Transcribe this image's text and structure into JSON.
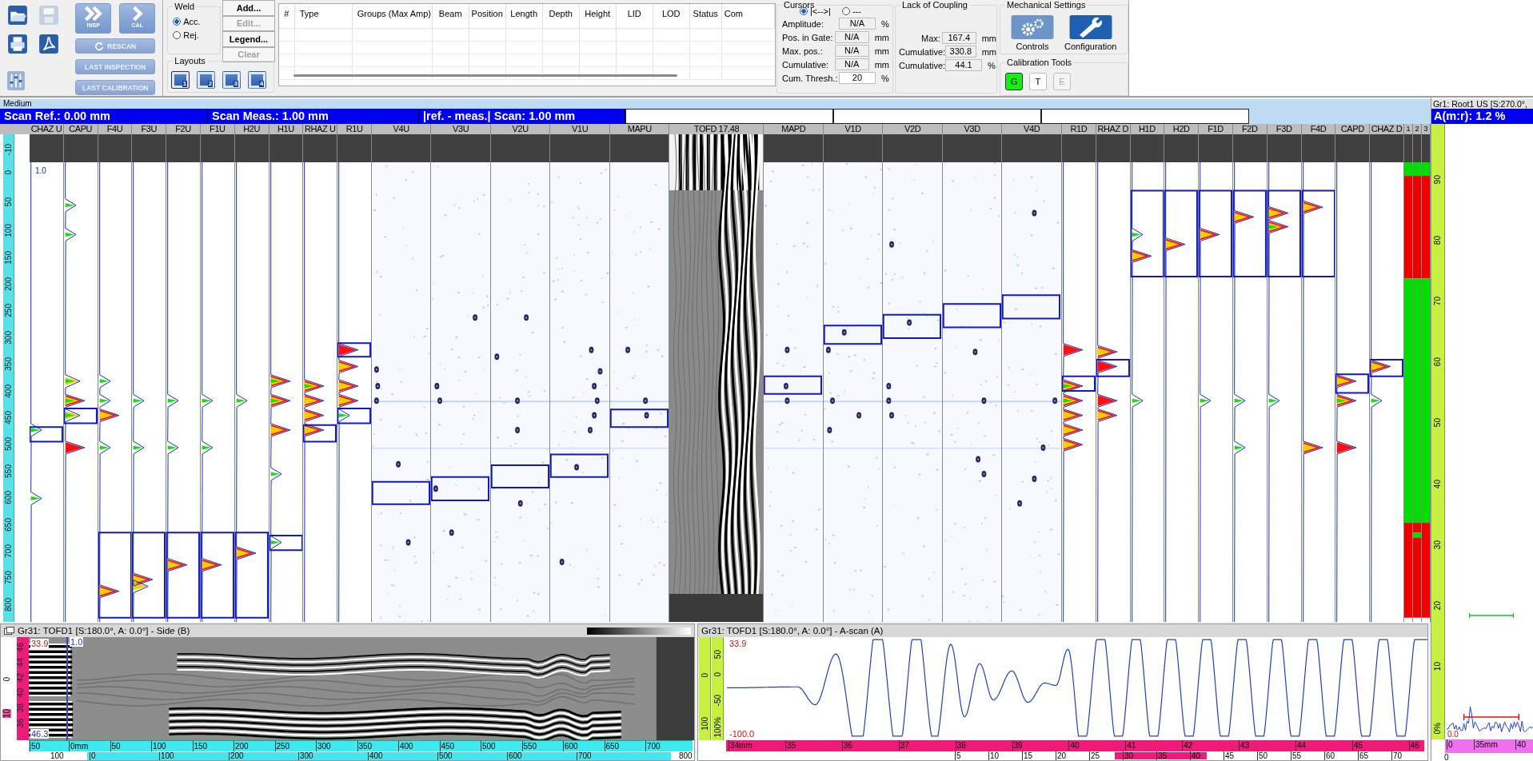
{
  "toolbar": {
    "mode_buttons": [
      {
        "label": "INSP"
      },
      {
        "label": "CAL"
      }
    ],
    "action_buttons": [
      {
        "label": "RESCAN"
      },
      {
        "label": "LAST INSPECTION"
      },
      {
        "label": "LAST CALIBRATION"
      }
    ],
    "weld": {
      "title": "Weld",
      "options": [
        {
          "label": "Acc.",
          "selected": true
        },
        {
          "label": "Rej.",
          "selected": false
        }
      ]
    },
    "indication_buttons": [
      {
        "label": "Add...",
        "disabled": false
      },
      {
        "label": "Edit...",
        "disabled": true
      },
      {
        "label": "Legend...",
        "disabled": false
      },
      {
        "label": "Clear",
        "disabled": true
      }
    ],
    "layouts": {
      "title": "Layouts",
      "buttons": [
        {
          "label": "1",
          "selected": true
        },
        {
          "label": "2",
          "selected": false
        },
        {
          "label": "3",
          "selected": false
        },
        {
          "label": "4",
          "selected": false
        }
      ]
    },
    "indication_table": {
      "columns": [
        "#",
        "Type",
        "Groups (Max Amp)",
        "Beam",
        "Position",
        "Length",
        "Depth",
        "Height",
        "LID",
        "LOD",
        "Status",
        "Com"
      ]
    },
    "cursors": {
      "title": "Cursors",
      "modes": [
        {
          "label": "|<-->|",
          "selected": true
        },
        {
          "label": "---",
          "selected": false
        }
      ],
      "rows": [
        {
          "label": "Amplitude:",
          "value": "N/A",
          "unit": "%",
          "kind": "readout"
        },
        {
          "label": "Pos. in Gate:",
          "value": "N/A",
          "unit": "mm",
          "kind": "readout"
        },
        {
          "label": "Max. pos.:",
          "value": "N/A",
          "unit": "mm",
          "kind": "readout"
        },
        {
          "label": "Cumulative:",
          "value": "N/A",
          "unit": "mm",
          "kind": "readout"
        },
        {
          "label": "Cum. Thresh.:",
          "value": "20",
          "unit": "%",
          "kind": "input"
        }
      ]
    },
    "lack_of_coupling": {
      "title": "Lack of Coupling",
      "rows": [
        {
          "label": "Max:",
          "value": "167.4",
          "unit": "mm"
        },
        {
          "label": "Cumulative:",
          "value": "330.8",
          "unit": "mm"
        },
        {
          "label": "Cumulative:",
          "value": "44.1",
          "unit": "%"
        }
      ]
    },
    "mechanical_settings": {
      "title": "Mechanical Settings",
      "buttons": [
        {
          "label": "Controls",
          "kind": "gears"
        },
        {
          "label": "Configuration",
          "kind": "wrench"
        }
      ]
    },
    "calibration_tools": {
      "title": "Calibration Tools",
      "buttons": [
        {
          "label": "G",
          "selected": true,
          "disabled": false
        },
        {
          "label": "T",
          "selected": false,
          "disabled": false
        },
        {
          "label": "E",
          "selected": false,
          "disabled": true
        }
      ]
    }
  },
  "strip_view": {
    "title": "Medium",
    "scan_fields": [
      "Scan Ref.: 0.00 mm",
      "Scan Meas.: 1.00 mm",
      "|ref. - meas.| Scan: 1.00 mm"
    ],
    "depth_ticks": [
      "-10",
      "0",
      "50",
      "100",
      "150",
      "200",
      "250",
      "300",
      "350",
      "400",
      "450",
      "500",
      "550",
      "600",
      "650",
      "700",
      "750",
      "800"
    ],
    "scale_label": "1.0",
    "channels": [
      {
        "label": "CHAZ U",
        "kind": "narrow"
      },
      {
        "label": "CAPU",
        "kind": "narrow"
      },
      {
        "label": "F4U",
        "kind": "narrow"
      },
      {
        "label": "F3U",
        "kind": "narrow"
      },
      {
        "label": "F2U",
        "kind": "narrow"
      },
      {
        "label": "F1U",
        "kind": "narrow"
      },
      {
        "label": "H2U",
        "kind": "narrow"
      },
      {
        "label": "H1U",
        "kind": "narrow"
      },
      {
        "label": "RHAZ U",
        "kind": "narrow"
      },
      {
        "label": "R1U",
        "kind": "narrow"
      },
      {
        "label": "V4U",
        "kind": "wide"
      },
      {
        "label": "V3U",
        "kind": "wide"
      },
      {
        "label": "V2U",
        "kind": "wide"
      },
      {
        "label": "V1U",
        "kind": "wide"
      },
      {
        "label": "MAPU",
        "kind": "wide"
      },
      {
        "label": "TOFD 17.48",
        "kind": "tofd"
      },
      {
        "label": "MAPD",
        "kind": "wide"
      },
      {
        "label": "V1D",
        "kind": "wide"
      },
      {
        "label": "V2D",
        "kind": "wide"
      },
      {
        "label": "V3D",
        "kind": "wide"
      },
      {
        "label": "V4D",
        "kind": "wide"
      },
      {
        "label": "R1D",
        "kind": "narrow"
      },
      {
        "label": "RHAZ D",
        "kind": "narrow"
      },
      {
        "label": "H1D",
        "kind": "narrow"
      },
      {
        "label": "H2D",
        "kind": "narrow"
      },
      {
        "label": "F1D",
        "kind": "narrow"
      },
      {
        "label": "F2D",
        "kind": "narrow"
      },
      {
        "label": "F3D",
        "kind": "narrow"
      },
      {
        "label": "F4D",
        "kind": "narrow"
      },
      {
        "label": "CAPD",
        "kind": "narrow"
      },
      {
        "label": "CHAZ D",
        "kind": "narrow"
      },
      {
        "label": "1",
        "kind": "status"
      },
      {
        "label": "2",
        "kind": "status"
      },
      {
        "label": "3",
        "kind": "status"
      }
    ]
  },
  "amplitude_panel": {
    "title": "Gr1: Root1 US [S:270.0°,",
    "reading": "A(m:r): 1.2 %",
    "ticks": [
      "90",
      "80",
      "70",
      "60",
      "50",
      "40",
      "30",
      "20",
      "10",
      "0%"
    ],
    "ascan_reading": "0.0",
    "axis_labels": [
      "0",
      "35mm",
      "40"
    ],
    "lower_labels": [
      "0"
    ]
  },
  "side_view": {
    "title": "Gr31: TOFD1 [S:180.0°, A: 0.0°] - Side (B)",
    "top_reading": "33.9",
    "cursor_reading": "1.0",
    "bottom_reading": "46.3",
    "left_labels": [
      "0",
      "10"
    ],
    "depth_ticks": [
      "36",
      "38",
      "40",
      "42",
      "44",
      "46"
    ],
    "scan_ticks": [
      "50",
      "0mm",
      "50",
      "100",
      "150",
      "200",
      "250",
      "300",
      "350",
      "400",
      "450",
      "500",
      "550",
      "600",
      "650",
      "700"
    ],
    "lower_ticks": [
      "100",
      "0",
      "100",
      "200",
      "300",
      "400",
      "500",
      "600",
      "700",
      "800"
    ]
  },
  "ascan_view": {
    "title": "Gr31: TOFD1 [S:180.0°, A: 0.0°] - A-scan (A)",
    "top_reading": "33.9",
    "bottom_reading": "-100.0",
    "ruler_a": [
      "100",
      "0"
    ],
    "ruler_b": [
      "100%",
      "-50",
      "0",
      "50"
    ],
    "time_ticks": [
      "34mm",
      "35",
      "36",
      "37",
      "38",
      "39",
      "40",
      "41",
      "42",
      "43",
      "44",
      "45",
      "46"
    ],
    "lower_ticks": [
      "5",
      "10",
      "15",
      "20",
      "25",
      "30",
      "35",
      "40",
      "45",
      "50",
      "55",
      "60",
      "65",
      "70"
    ]
  }
}
